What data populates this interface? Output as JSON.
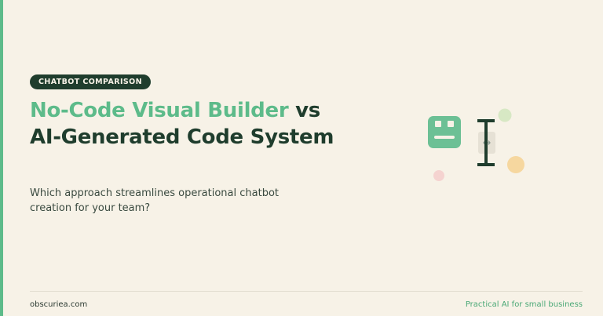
{
  "badge": "CHATBOT COMPARISON",
  "headline": {
    "accent": "No-Code Visual Builder",
    "connector": " vs",
    "rest": "AI-Generated Code System"
  },
  "subtitle": "Which approach streamlines operational chatbot creation for your team?",
  "footer": {
    "site": "obscuriea.com",
    "tagline": "Practical AI for small business"
  },
  "colors": {
    "background": "#f7f2e7",
    "accent_green": "#5dbb8a",
    "dark_green": "#1f3d2d",
    "light_green_dot": "#d7e8c4",
    "orange_dot": "#f6d79f",
    "pink_dot": "#f5d3d0"
  },
  "icons": [
    "robot-icon",
    "text-cursor-icon"
  ]
}
